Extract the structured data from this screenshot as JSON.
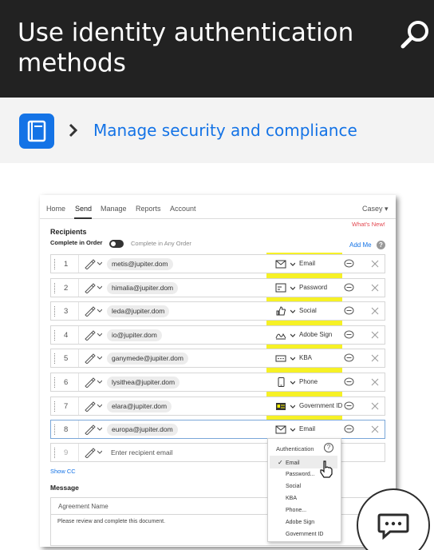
{
  "header": {
    "title": "Use identity authentication methods",
    "search_icon": "search-icon"
  },
  "breadcrumb": {
    "icon": "book-icon",
    "link_label": "Manage security and compliance"
  },
  "screenshot": {
    "nav": {
      "items": [
        "Home",
        "Send",
        "Manage",
        "Reports",
        "Account"
      ],
      "active": "Send",
      "user": "Casey"
    },
    "whats_new": "What's New!",
    "recipients_heading": "Recipients",
    "complete_in_order": "Complete in Order",
    "complete_in_any_order": "Complete in Any Order",
    "add_me": "Add Me",
    "help_glyph": "?",
    "recipients": [
      {
        "num": "1",
        "email": "metis@jupiter.dom",
        "auth": "Email",
        "auth_icon": "envelope-icon"
      },
      {
        "num": "2",
        "email": "himalia@jupiter.dom",
        "auth": "Password",
        "auth_icon": "password-icon"
      },
      {
        "num": "3",
        "email": "leda@jupiter.dom",
        "auth": "Social",
        "auth_icon": "thumbs-up-icon"
      },
      {
        "num": "4",
        "email": "io@jupiter.dom",
        "auth": "Adobe Sign",
        "auth_icon": "signature-icon"
      },
      {
        "num": "5",
        "email": "ganymede@jupiter.dom",
        "auth": "KBA",
        "auth_icon": "kba-icon"
      },
      {
        "num": "6",
        "email": "lysithea@jupiter.dom",
        "auth": "Phone",
        "auth_icon": "phone-icon"
      },
      {
        "num": "7",
        "email": "elara@jupiter.dom",
        "auth": "Government ID",
        "auth_icon": "id-card-icon"
      },
      {
        "num": "8",
        "email": "europa@jupiter.dom",
        "auth": "Email",
        "auth_icon": "envelope-icon"
      }
    ],
    "new_recipient": {
      "num": "9",
      "placeholder": "Enter recipient email"
    },
    "show_cc": "Show CC",
    "message_heading": "Message",
    "agreement_name_placeholder": "Agreement Name",
    "message_placeholder": "Please review and complete this document.",
    "auth_dropdown": {
      "title": "Authentication",
      "options": [
        "Email",
        "Password...",
        "Social",
        "KBA",
        "Phone...",
        "Adobe Sign",
        "Government ID"
      ],
      "selected": "Email"
    },
    "highlight_color": "#f5ef00"
  },
  "chat_button": {
    "icon": "chat-bubble-icon"
  },
  "colors": {
    "header_bg": "#222222",
    "accent": "#1473e6",
    "band_bg": "#f3f3f3"
  }
}
